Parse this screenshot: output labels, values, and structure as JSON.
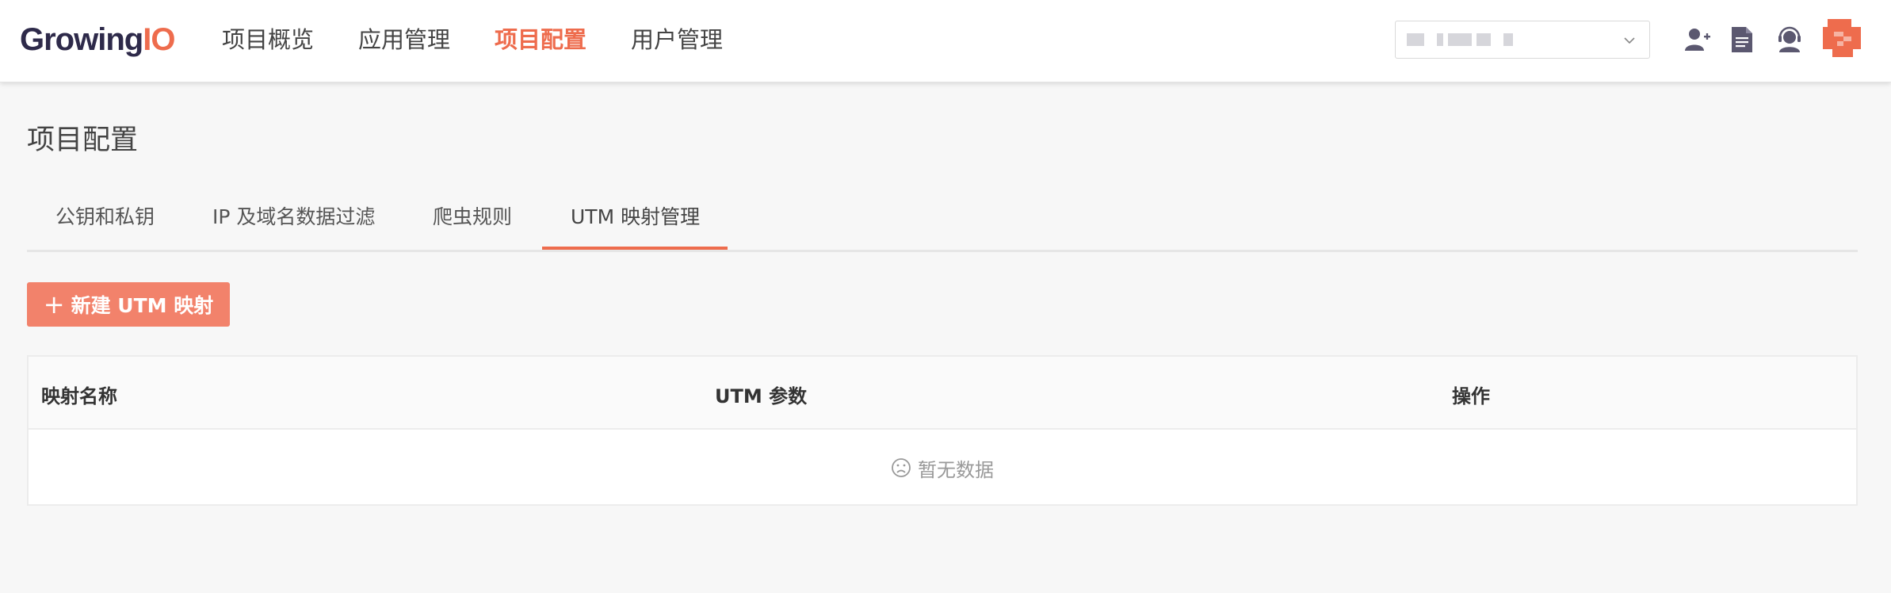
{
  "header": {
    "logo_main": "Growing",
    "logo_accent": "IO",
    "nav": [
      {
        "label": "项目概览"
      },
      {
        "label": "应用管理"
      },
      {
        "label": "项目配置"
      },
      {
        "label": "用户管理"
      }
    ],
    "active_nav": "项目配置",
    "icons": [
      "add-user-icon",
      "document-icon",
      "support-agent-icon",
      "avatar"
    ]
  },
  "page": {
    "title": "项目配置"
  },
  "tabs": [
    {
      "label": "公钥和私钥"
    },
    {
      "label": "IP 及域名数据过滤"
    },
    {
      "label": "爬虫规则"
    },
    {
      "label": "UTM 映射管理"
    }
  ],
  "active_tab": "UTM 映射管理",
  "actions": {
    "new_button_label": "新建 UTM 映射",
    "new_button_icon": "plus-icon"
  },
  "table": {
    "columns": [
      "映射名称",
      "UTM 参数",
      "操作"
    ],
    "rows": [],
    "empty_text": "暂无数据",
    "empty_icon": "frown-icon"
  },
  "colors": {
    "accent": "#ee6c4d",
    "button": "#f2826b",
    "logo_dark": "#2e2a4a"
  }
}
